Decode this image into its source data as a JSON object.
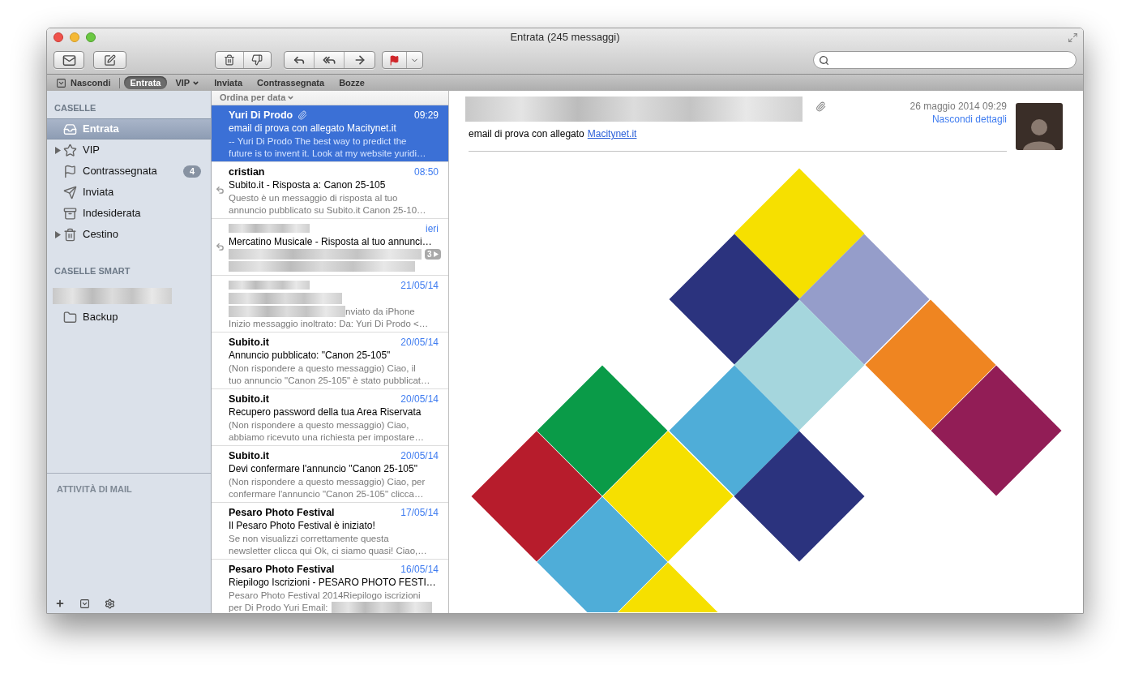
{
  "window": {
    "title": "Entrata (245 messaggi)"
  },
  "hide_button": {
    "label": "Nascondi"
  },
  "favorites": [
    {
      "label": "Entrata",
      "selected": true,
      "has_menu": false
    },
    {
      "label": "VIP",
      "selected": false,
      "has_menu": true
    },
    {
      "label": "Inviata",
      "selected": false,
      "has_menu": false
    },
    {
      "label": "Contrassegnata",
      "selected": false,
      "has_menu": false
    },
    {
      "label": "Bozze",
      "selected": false,
      "has_menu": false
    }
  ],
  "sidebar": {
    "sections": [
      {
        "title": "CASELLE",
        "items": [
          {
            "label": "Entrata",
            "selected": true,
            "expandable": false
          },
          {
            "label": "VIP",
            "selected": false,
            "expandable": true
          },
          {
            "label": "Contrassegnata",
            "selected": false,
            "expandable": false,
            "badge": "4"
          },
          {
            "label": "Inviata",
            "selected": false,
            "expandable": false
          },
          {
            "label": "Indesiderata",
            "selected": false,
            "expandable": false
          },
          {
            "label": "Cestino",
            "selected": false,
            "expandable": true
          }
        ]
      },
      {
        "title": "CASELLE SMART",
        "items": [
          {
            "redacted": true,
            "selected": false,
            "expandable": false
          },
          {
            "label": "Backup",
            "selected": false,
            "expandable": false
          }
        ]
      }
    ],
    "activity_title": "ATTIVITÀ DI MAIL"
  },
  "message_list": {
    "sort_label": "Ordina per data",
    "messages": [
      {
        "sender": "Yuri Di Prodo",
        "date": "09:29",
        "subject": "email di prova con allegato Macitynet.it",
        "preview_lines": [
          "-- Yuri Di Prodo The best way to predict the",
          "future is to invent it. Look at my website yuridi…"
        ],
        "attachment": true,
        "replied": false,
        "selected": true
      },
      {
        "sender": "cristian",
        "date": "08:50",
        "subject": "Subito.it - Risposta a: Canon 25-105",
        "preview_lines": [
          "Questo è un messaggio di risposta al tuo",
          "annuncio pubblicato su Subito.it Canon 25-10…"
        ],
        "attachment": false,
        "replied": true,
        "selected": false
      },
      {
        "sender_redacted": true,
        "date": "ieri",
        "subject": "Mercatino Musicale - Risposta al tuo annunci…",
        "preview_redacted": true,
        "thread_count": "3",
        "attachment": false,
        "replied": true,
        "selected": false
      },
      {
        "sender_redacted": true,
        "date": "21/05/14",
        "subject_redacted": true,
        "preview_lead_redacted": true,
        "preview_lines": [
          "nviato da iPhone",
          "Inizio messaggio inoltrato: Da: Yuri Di Prodo <…"
        ],
        "attachment": false,
        "replied": false,
        "selected": false
      },
      {
        "sender": "Subito.it",
        "date": "20/05/14",
        "subject": "Annuncio pubblicato: \"Canon 25-105\"",
        "preview_lines": [
          "(Non rispondere a questo messaggio) Ciao, il",
          "tuo annuncio \"Canon 25-105\" è stato pubblicat…"
        ],
        "attachment": false,
        "replied": false,
        "selected": false
      },
      {
        "sender": "Subito.it",
        "date": "20/05/14",
        "subject": "Recupero password della tua Area Riservata",
        "preview_lines": [
          "(Non rispondere a questo messaggio) Ciao,",
          "abbiamo ricevuto una richiesta per impostare…"
        ],
        "attachment": false,
        "replied": false,
        "selected": false
      },
      {
        "sender": "Subito.it",
        "date": "20/05/14",
        "subject": "Devi confermare l'annuncio \"Canon 25-105\"",
        "preview_lines": [
          "(Non rispondere a questo messaggio) Ciao, per",
          "confermare l'annuncio \"Canon 25-105\" clicca…"
        ],
        "attachment": false,
        "replied": false,
        "selected": false
      },
      {
        "sender": "Pesaro Photo Festival",
        "date": "17/05/14",
        "subject": "Il Pesaro Photo Festival è iniziato!",
        "preview_lines": [
          "Se non visualizzi correttamente questa",
          "newsletter clicca qui Ok, ci siamo quasi! Ciao,…"
        ],
        "attachment": false,
        "replied": false,
        "selected": false
      },
      {
        "sender": "Pesaro Photo Festival",
        "date": "16/05/14",
        "subject": "Riepilogo Iscrizioni - PESARO PHOTO FESTI…",
        "preview_lines": [
          "Pesaro Photo Festival 2014Riepilogo iscrizioni",
          "per Di Prodo Yuri Email:"
        ],
        "preview_tail_redacted": true,
        "attachment": false,
        "replied": false,
        "selected": false
      }
    ]
  },
  "preview": {
    "sender_redacted": true,
    "attachment": true,
    "date": "26 maggio 2014 09:29",
    "details_link": "Nascondi dettagli",
    "subject": "email di prova con allegato",
    "subject_link": "Macitynet.it"
  }
}
